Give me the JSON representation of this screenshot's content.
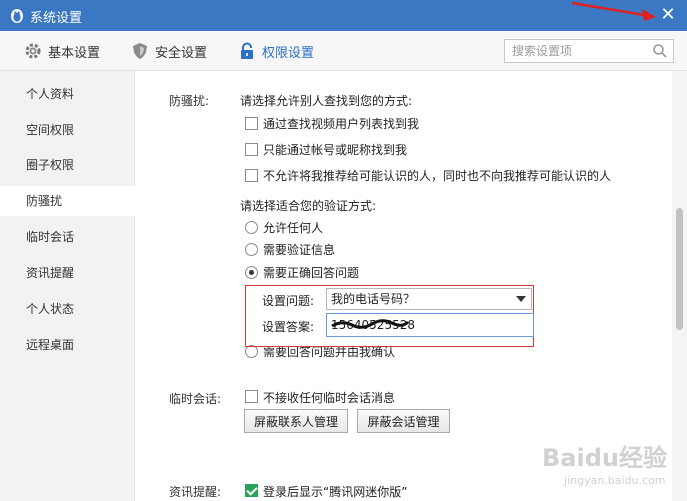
{
  "window": {
    "title": "系统设置",
    "close_label": "✕"
  },
  "tabs": [
    {
      "label": "基本设置",
      "icon": "gear-icon"
    },
    {
      "label": "安全设置",
      "icon": "shield-icon"
    },
    {
      "label": "权限设置",
      "icon": "lock-icon",
      "active": true
    }
  ],
  "search": {
    "placeholder": "搜索设置项"
  },
  "sidebar": {
    "items": [
      {
        "label": "个人资料"
      },
      {
        "label": "空间权限"
      },
      {
        "label": "圈子权限"
      },
      {
        "label": "防骚扰",
        "active": true
      },
      {
        "label": "临时会话"
      },
      {
        "label": "资讯提醒"
      },
      {
        "label": "个人状态"
      },
      {
        "label": "远程桌面"
      }
    ]
  },
  "anti_harass": {
    "section_label": "防骚扰:",
    "find_prompt": "请选择允许别人查找到您的方式:",
    "find_options": [
      {
        "label": "通过查找视频用户列表找到我",
        "checked": false
      },
      {
        "label": "只能通过帐号或昵称找到我",
        "checked": false
      },
      {
        "label": "不允许将我推荐给可能认识的人，同时也不向我推荐可能认识的人",
        "checked": false
      }
    ],
    "verify_prompt": "请选择适合您的验证方式:",
    "verify_options": [
      {
        "label": "允许任何人",
        "checked": false
      },
      {
        "label": "需要验证信息",
        "checked": false
      },
      {
        "label": "需要正确回答问题",
        "checked": true
      },
      {
        "label": "需要回答问题并由我确认",
        "checked": false
      }
    ],
    "question_label": "设置问题:",
    "question_value": "我的电话号码？",
    "answer_label": "设置答案:",
    "answer_value": "15640525528"
  },
  "temp_session": {
    "section_label": "临时会话:",
    "option": {
      "label": "不接收任何临时会话消息",
      "checked": false
    },
    "buttons": {
      "contacts": "屏蔽联系人管理",
      "sessions": "屏蔽会话管理"
    }
  },
  "news": {
    "section_label": "资讯提醒:",
    "option": {
      "label": "登录后显示“腾讯网迷你版”",
      "checked": true
    }
  },
  "watermark": {
    "text": "Baidu经验",
    "subtext": "jingyan.baidu.com"
  },
  "colors": {
    "titlebar": "#3b78c4",
    "accent": "#2a6fc9",
    "highlight_box": "#d23a3a",
    "checked": "#2aa35a"
  }
}
